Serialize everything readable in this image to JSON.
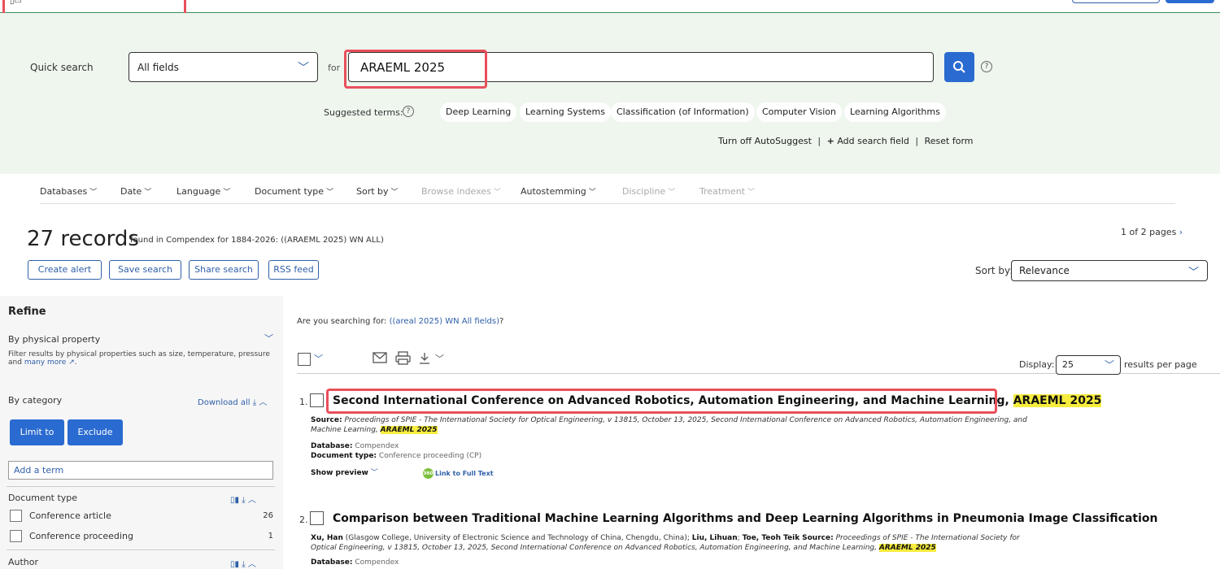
{
  "search": {
    "quick_search_label": "Quick search",
    "field": "All fields",
    "for_label": "for",
    "query": "ARAEML 2025",
    "suggested_label": "Suggested terms:",
    "help": "?",
    "suggested_terms": [
      "Deep Learning",
      "Learning Systems",
      "Classification (of Information)",
      "Computer Vision",
      "Learning Algorithms"
    ],
    "links": {
      "autosuggest": "Turn off AutoSuggest",
      "add_field": "Add search field",
      "reset": "Reset form",
      "sep": "|"
    }
  },
  "options": {
    "databases": "Databases",
    "date": "Date",
    "language": "Language",
    "doctype": "Document type",
    "sortby": "Sort by",
    "browse": "Browse indexes",
    "autostemming": "Autostemming",
    "discipline": "Discipline",
    "treatment": "Treatment"
  },
  "results_header": {
    "count": "27 records",
    "desc": "found in Compendex for 1884-2026: ((ARAEML 2025) WN ALL)",
    "pages": "1 of 2 pages",
    "buttons": [
      "Create alert",
      "Save search",
      "Share search",
      "RSS feed"
    ],
    "sort_label": "Sort by:",
    "sort_value": "Relevance"
  },
  "refine": {
    "title": "Refine",
    "physical": "By physical property",
    "physical_desc": "Filter results by physical properties such as size, temperature, pressure and",
    "many_more": "many more",
    "category": "By category",
    "download_all": "Download all",
    "limit_to": "Limit to",
    "exclude": "Exclude",
    "add_term": "Add a term",
    "doctype_head": "Document type",
    "doctype_items": [
      {
        "label": "Conference article",
        "count": "26"
      },
      {
        "label": "Conference proceeding",
        "count": "1"
      }
    ],
    "author_head": "Author"
  },
  "results": {
    "suggest_prefix": "Are you searching for:",
    "suggest_query": "((areal 2025) WN All fields)",
    "suggest_suffix": "?",
    "display_label": "Display:",
    "display_value": "25",
    "rpp_label": "results per page",
    "items": [
      {
        "num": "1.",
        "title": "Second International Conference on Advanced Robotics, Automation Engineering, and Machine Learning,",
        "title_hl": "ARAEML 2025",
        "source_label": "Source:",
        "source": "Proceedings of SPIE - The International Society for Optical Engineering, v 13815, October 13, 2025, Second International Conference on Advanced Robotics, Automation Engineering, and",
        "source_cont": "Machine Learning,",
        "source_hl": "ARAEML 2025",
        "db_label": "Database:",
        "db": "Compendex",
        "dt_label": "Document type:",
        "dt": "Conference proceeding (CP)",
        "preview": "Show preview",
        "fulltext_badge": "360",
        "fulltext": "Link to Full Text"
      },
      {
        "num": "2.",
        "title": "Comparison between Traditional Machine Learning Algorithms and Deep Learning Algorithms in Pneumonia Image Classification",
        "author1": "Xu, Han",
        "aff1": "(Glasgow College, University of Electronic Science and Technology of China, Chengdu, China);",
        "author2": "Liu, Lihuan",
        "author3": "Toe, Teoh Teik",
        "source_label": "Source:",
        "source": "Proceedings of SPIE - The International Society for",
        "source_cont": "Optical Engineering, v 13815, October 13, 2025, Second International Conference on Advanced Robotics, Automation Engineering, and Machine Learning,",
        "source_hl": "ARAEML 2025",
        "db_label": "Database:",
        "db": "Compendex"
      }
    ]
  }
}
